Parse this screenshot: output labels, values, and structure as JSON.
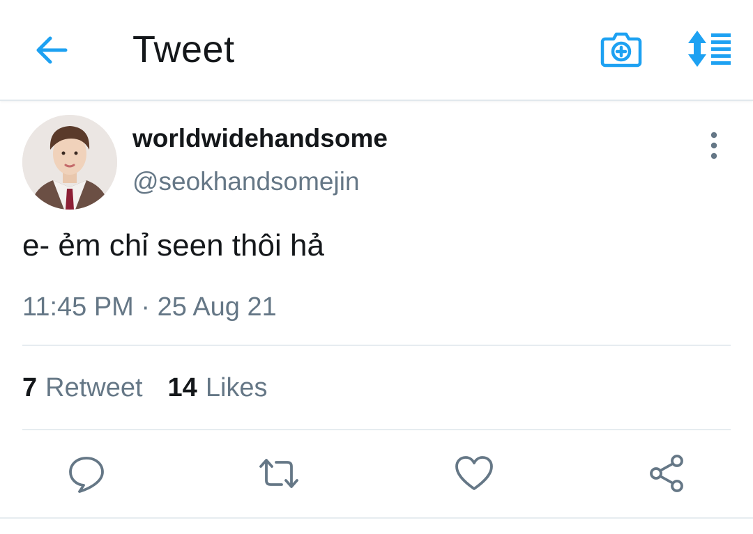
{
  "header": {
    "title": "Tweet",
    "back_icon": "arrow-left-icon",
    "camera_icon": "camera-add-icon",
    "sort_icon": "sort-list-icon",
    "accent_color": "#1da1f2"
  },
  "tweet": {
    "display_name": "worldwidehandsome",
    "handle": "@seokhandsomejin",
    "text": "e- ẻm chỉ seen thôi hả",
    "timestamp": "11:45 PM · 25 Aug 21",
    "more_icon": "more-vertical-icon"
  },
  "stats": {
    "retweet_count": "7",
    "retweet_label": "Retweet",
    "likes_count": "14",
    "likes_label": "Likes"
  },
  "actions": [
    {
      "icon": "reply-icon"
    },
    {
      "icon": "retweet-icon"
    },
    {
      "icon": "like-icon"
    },
    {
      "icon": "share-icon"
    }
  ]
}
